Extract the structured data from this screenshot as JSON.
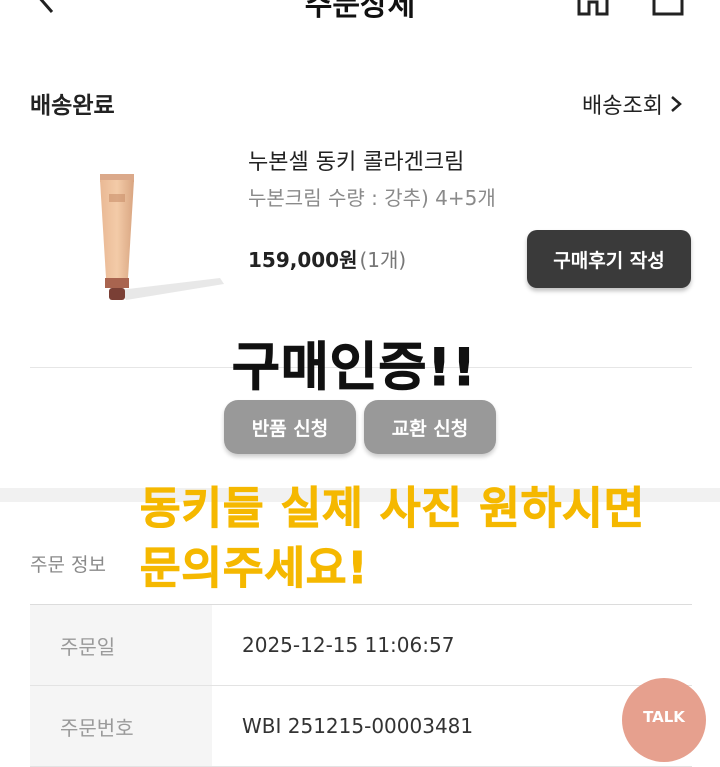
{
  "header": {
    "title": "주문상세",
    "back_icon": "chevron-left-icon",
    "home_icon": "home-icon",
    "cart_icon": "cart-icon"
  },
  "order": {
    "status": "배송완료",
    "track_label": "배송조회"
  },
  "product": {
    "name": "누본셀 동키 콜라겐크림",
    "option": "누본크림 수량 : 강추) 4+5개",
    "price": "159,000원",
    "qty": "(1개)",
    "review_button": "구매후기 작성"
  },
  "actions": {
    "return_button": "반품 신청",
    "exchange_button": "교환 신청"
  },
  "overlay": {
    "certification": "구매인증!!",
    "line1": "동키들 실제 사진 원하시면",
    "line2": "문의주세요!"
  },
  "order_info": {
    "title": "주문 정보",
    "rows": [
      {
        "label": "주문일",
        "value": "2025-12-15 11:06:57"
      },
      {
        "label": "주문번호",
        "value": "WBI 251215-00003481"
      }
    ]
  },
  "talk_button": "TALK",
  "colors": {
    "review_button_bg": "#3a3a3a",
    "action_button_bg": "#999999",
    "overlay_yellow": "#f5b800",
    "talk_bg": "#e6a08e"
  }
}
